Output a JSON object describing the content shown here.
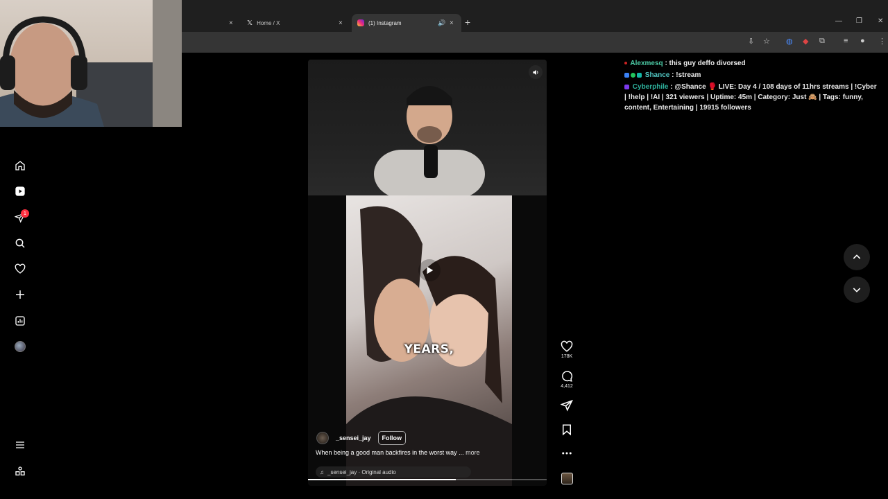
{
  "browser": {
    "tabs": [
      {
        "label": "",
        "close": "×"
      },
      {
        "label": "Home / X",
        "close": "×"
      },
      {
        "label": "(1) Instagram",
        "close": "×"
      }
    ],
    "new_tab": "+",
    "window_controls": [
      "—",
      "❐",
      "✕"
    ]
  },
  "sidebar": {
    "notification_count": "1",
    "icons": [
      "home-icon",
      "reels-icon",
      "messages-icon",
      "search-icon",
      "notifications-icon",
      "create-icon",
      "dashboard-icon",
      "profile-avatar",
      "more-menu-icon",
      "also-from-meta-icon"
    ]
  },
  "reel": {
    "caption_word": "YEARS,",
    "username": "_sensei_jay",
    "follow_label": "Follow",
    "description": "When being a good man backfires in the worst way ...",
    "more_label": "more",
    "audio": "_sensei_jay · Original audio",
    "progress": 0.62
  },
  "actions": {
    "likes": "178K",
    "comments": "4,412"
  },
  "chat": [
    {
      "user": "Alexmesq",
      "message": ": this guy deffo divorsed"
    },
    {
      "user": "Shance",
      "message": ": !stream"
    },
    {
      "user": "Cyberphile",
      "message": ": @Shance 🥊 LIVE: Day 4 / 108 days of 11hrs streams | !Cyber | !help | !AI | 321 viewers | Uptime: 45m | Category: Just 🙈 | Tags: funny, content, Entertaining | 19915 followers"
    }
  ],
  "colors": {
    "badge": "#ff3040",
    "chat_user": "#4bc9a4"
  }
}
